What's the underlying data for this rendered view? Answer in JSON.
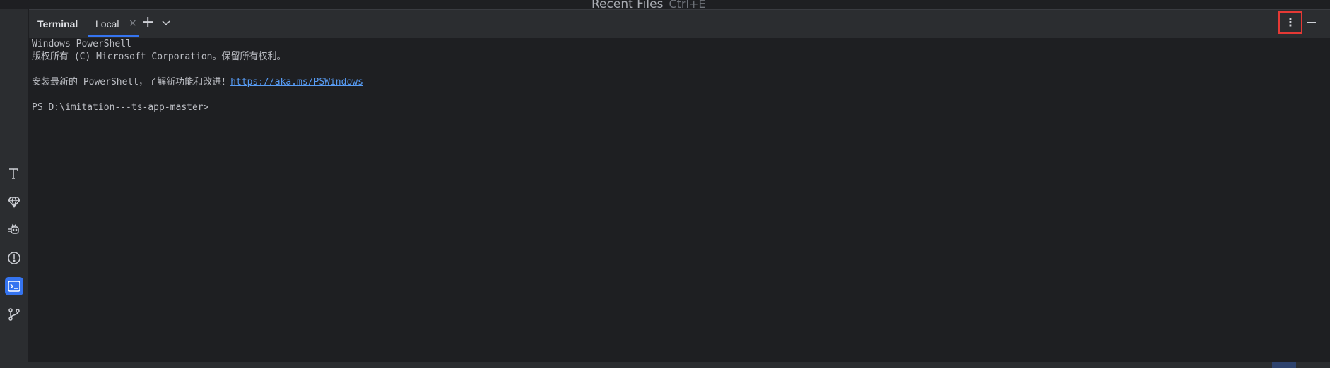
{
  "top_hint": {
    "label": "Recent Files",
    "shortcut": "Ctrl+E"
  },
  "left_toolbar": {
    "items": [
      {
        "name": "text-tool-icon",
        "active": false
      },
      {
        "name": "gem-icon",
        "active": false
      },
      {
        "name": "cat-icon",
        "active": false
      },
      {
        "name": "problems-icon",
        "active": false
      },
      {
        "name": "terminal-icon",
        "active": true
      },
      {
        "name": "git-branch-icon",
        "active": false
      }
    ]
  },
  "terminal": {
    "title": "Terminal",
    "tabs": [
      {
        "label": "Local",
        "active": true
      }
    ],
    "close_glyph": "×",
    "add_glyph": "+",
    "options_glyph": "⋮",
    "output": {
      "line1": "Windows PowerShell",
      "line2": "版权所有 (C) Microsoft Corporation。保留所有权利。",
      "line3_prefix": "安装最新的 PowerShell，了解新功能和改进！",
      "line3_link": "https://aka.ms/PSWindows",
      "line4": "PS D:\\imitation---ts-app-master>"
    }
  },
  "colors": {
    "background": "#1e1f22",
    "panel": "#2b2d30",
    "accent": "#3574f0",
    "link": "#589df6",
    "highlight_border": "#e53935"
  }
}
